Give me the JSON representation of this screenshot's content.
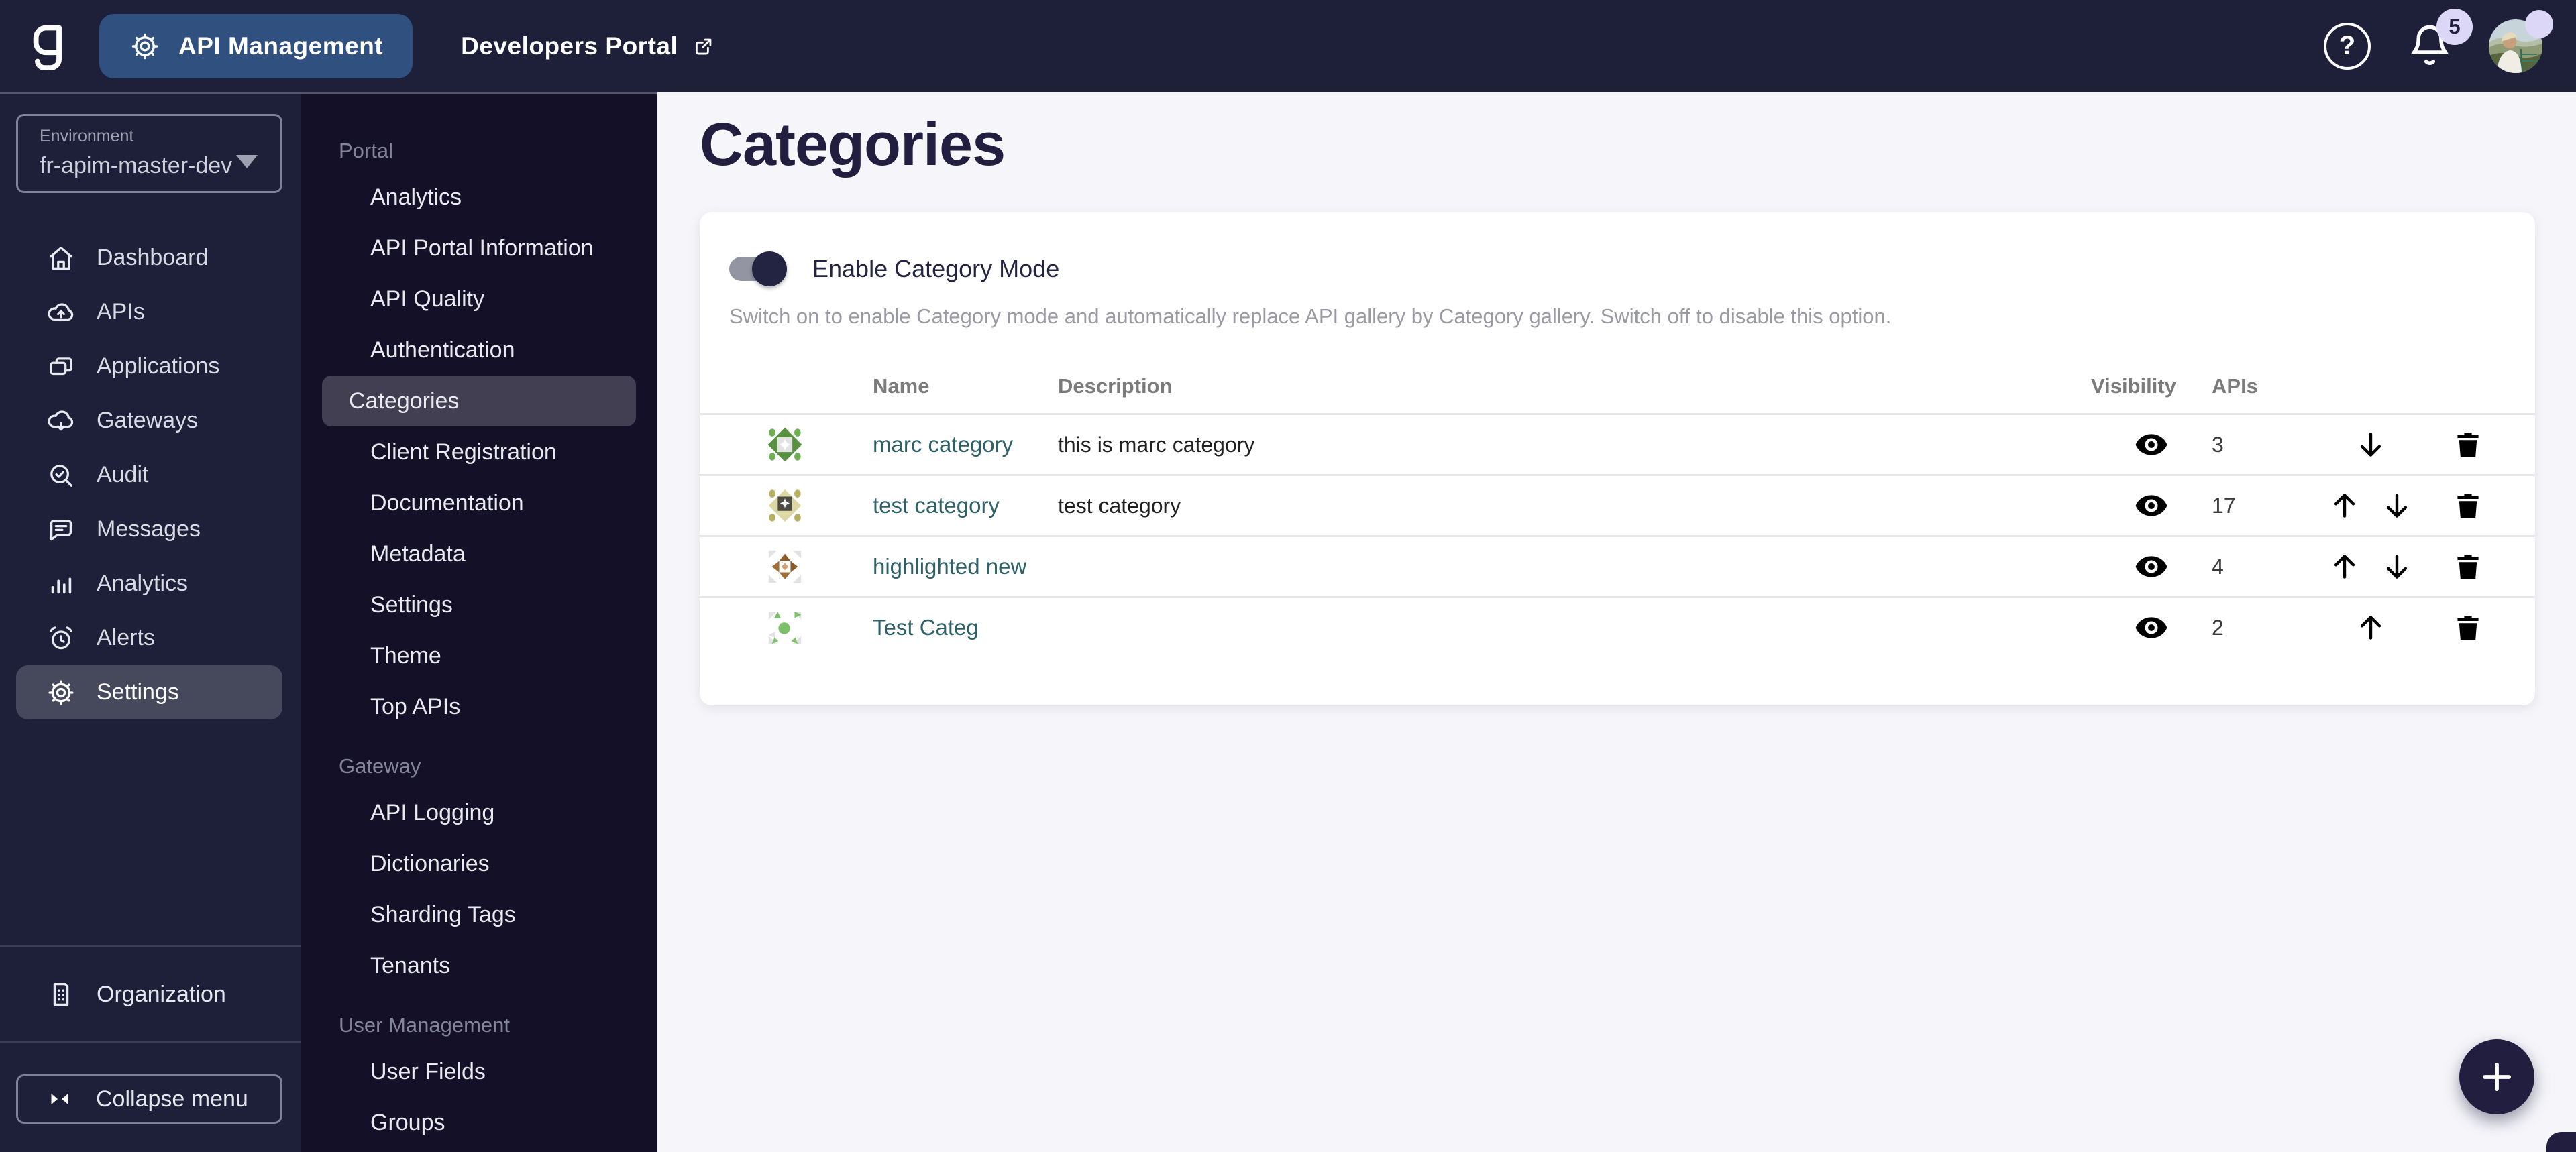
{
  "topbar": {
    "product_label": "API Management",
    "portal_link_label": "Developers Portal",
    "notification_count": "5"
  },
  "environment": {
    "label": "Environment",
    "value": "fr-apim-master-dev"
  },
  "sidebar": {
    "items": [
      {
        "label": "Dashboard",
        "icon": "home-icon",
        "active": false
      },
      {
        "label": "APIs",
        "icon": "cloud-upload-icon",
        "active": false
      },
      {
        "label": "Applications",
        "icon": "applications-icon",
        "active": false
      },
      {
        "label": "Gateways",
        "icon": "cloud-download-icon",
        "active": false
      },
      {
        "label": "Audit",
        "icon": "audit-search-icon",
        "active": false
      },
      {
        "label": "Messages",
        "icon": "message-icon",
        "active": false
      },
      {
        "label": "Analytics",
        "icon": "bar-chart-icon",
        "active": false
      },
      {
        "label": "Alerts",
        "icon": "alarm-icon",
        "active": false
      },
      {
        "label": "Settings",
        "icon": "gear-icon",
        "active": true
      }
    ],
    "organization_label": "Organization",
    "collapse_label": "Collapse menu"
  },
  "subsidebar": {
    "sections": [
      {
        "title": "Portal",
        "items": [
          "Analytics",
          "API Portal Information",
          "API Quality",
          "Authentication",
          "Categories",
          "Client Registration",
          "Documentation",
          "Metadata",
          "Settings",
          "Theme",
          "Top APIs"
        ]
      },
      {
        "title": "Gateway",
        "items": [
          "API Logging",
          "Dictionaries",
          "Sharding Tags",
          "Tenants"
        ]
      },
      {
        "title": "User Management",
        "items": [
          "User Fields",
          "Groups"
        ]
      }
    ],
    "active_item": "Categories"
  },
  "page": {
    "title": "Categories"
  },
  "category_mode": {
    "label": "Enable Category Mode",
    "enabled": true,
    "description": "Switch on to enable Category mode and automatically replace API gallery by Category gallery. Switch off to disable this option."
  },
  "table": {
    "columns": {
      "name": "Name",
      "description": "Description",
      "visibility": "Visibility",
      "apis": "APIs"
    },
    "rows": [
      {
        "name": "marc category",
        "description": "this is marc category",
        "visibility": "visible",
        "apis": "3",
        "move_up": false,
        "move_down": true,
        "icon": "green-diamond-star"
      },
      {
        "name": "test category",
        "description": "test category",
        "visibility": "visible",
        "apis": "17",
        "move_up": true,
        "move_down": true,
        "icon": "olive-diamond-spark"
      },
      {
        "name": "highlighted new",
        "description": "",
        "visibility": "visible",
        "apis": "4",
        "move_up": true,
        "move_down": true,
        "icon": "brown-pinwheel"
      },
      {
        "name": "Test Categ",
        "description": "",
        "visibility": "visible",
        "apis": "2",
        "move_up": true,
        "move_down": false,
        "icon": "green-dot-burst"
      }
    ]
  },
  "fab": {
    "label": "add-category"
  },
  "colors": {
    "topbar": "#1e2039",
    "subsidebar": "#131028",
    "accent_blue": "#30507f",
    "ink": "#211e40",
    "link_teal": "#2d6167",
    "badge_lavender": "#dcd7f6"
  }
}
